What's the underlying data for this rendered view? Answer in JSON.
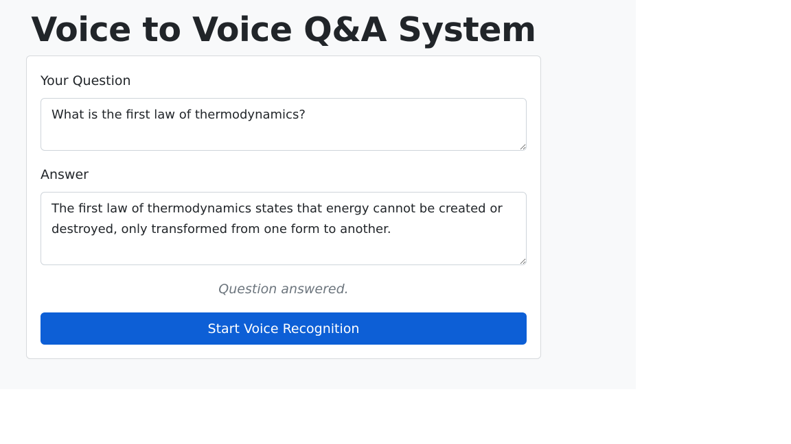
{
  "page": {
    "title": "Voice to Voice Q&A System"
  },
  "form": {
    "question_label": "Your Question",
    "question_value": "What is the first law of thermodynamics?",
    "answer_label": "Answer",
    "answer_value": "The first law of thermodynamics states that energy cannot be created or destroyed, only transformed from one form to another.",
    "status_text": "Question answered.",
    "start_button_label": "Start Voice Recognition"
  },
  "colors": {
    "page_background": "#f8f9fa",
    "card_background": "#ffffff",
    "primary_button": "#0d5fd6",
    "status_text": "#6c757d"
  }
}
